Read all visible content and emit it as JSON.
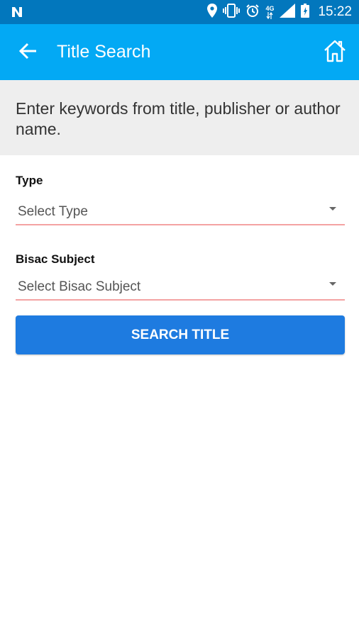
{
  "status_bar": {
    "network_type": "4G",
    "time": "15:22"
  },
  "app_bar": {
    "title": "Title Search",
    "back_icon": "arrow-left-icon",
    "home_icon": "home-icon"
  },
  "instructions": {
    "text": "Enter keywords from title, publisher or author name."
  },
  "form": {
    "type_label": "Type",
    "type_value": "Select Type",
    "bisac_label": "Bisac Subject",
    "bisac_value": "Select Bisac Subject",
    "search_button": "SEARCH TITLE"
  },
  "colors": {
    "status_bar": "#0277bd",
    "app_bar": "#03a9f4",
    "button": "#1e7be0",
    "underline": "#f4a3a3"
  }
}
